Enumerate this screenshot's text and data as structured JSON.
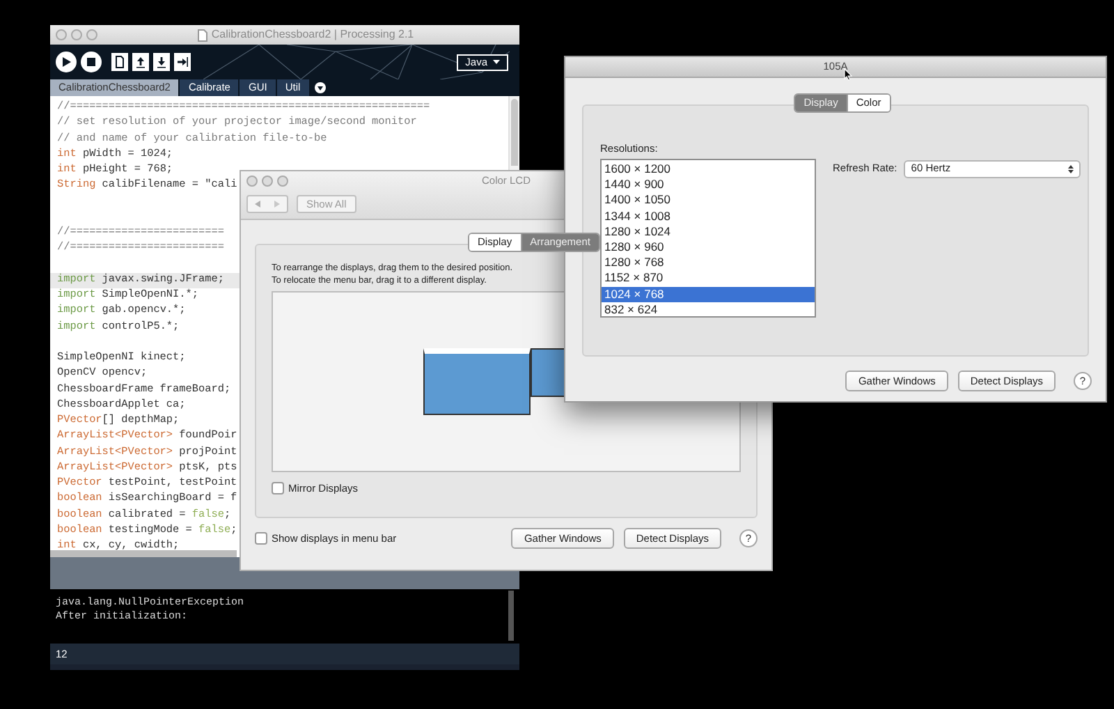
{
  "processing_window": {
    "title": "CalibrationChessboard2 | Processing 2.1",
    "toolbar": {
      "buttons": [
        {
          "kind": "run"
        },
        {
          "kind": "stop"
        },
        {
          "kind": "new"
        },
        {
          "kind": "open"
        },
        {
          "kind": "save"
        },
        {
          "kind": "export"
        }
      ],
      "mode": "Java"
    },
    "tabs": [
      {
        "label": "CalibrationChessboard2",
        "selected": true
      },
      {
        "label": "Calibrate",
        "selected": false
      },
      {
        "label": "GUI",
        "selected": false
      },
      {
        "label": "Util",
        "selected": false
      }
    ],
    "code_lines": [
      {
        "kind": "code",
        "highlighted": false,
        "segments": [
          {
            "text": "//========================================================",
            "kind": "comment"
          }
        ]
      },
      {
        "kind": "code",
        "highlighted": false,
        "segments": [
          {
            "text": "// set resolution of your projector image/second monitor",
            "kind": "comment"
          }
        ]
      },
      {
        "kind": "code",
        "highlighted": false,
        "segments": [
          {
            "text": "// and name of your calibration file-to-be",
            "kind": "comment"
          }
        ]
      },
      {
        "kind": "code",
        "highlighted": false,
        "segments": [
          {
            "text": "int",
            "kind": "type"
          },
          {
            "text": " pWidth = 1024;",
            "kind": "plain"
          }
        ]
      },
      {
        "kind": "code",
        "highlighted": false,
        "segments": [
          {
            "text": "int",
            "kind": "type"
          },
          {
            "text": " pHeight = 768;",
            "kind": "plain"
          }
        ]
      },
      {
        "kind": "code",
        "highlighted": false,
        "segments": [
          {
            "text": "String",
            "kind": "type"
          },
          {
            "text": " calibFilename = \"cali",
            "kind": "plain"
          }
        ]
      },
      {
        "kind": "blank"
      },
      {
        "kind": "blank"
      },
      {
        "kind": "code",
        "highlighted": false,
        "segments": [
          {
            "text": "//========================",
            "kind": "comment"
          }
        ]
      },
      {
        "kind": "code",
        "highlighted": false,
        "segments": [
          {
            "text": "//========================",
            "kind": "comment"
          }
        ]
      },
      {
        "kind": "blank"
      },
      {
        "kind": "code",
        "highlighted": true,
        "segments": [
          {
            "text": "import",
            "kind": "keyword"
          },
          {
            "text": " javax.swing.JFrame;",
            "kind": "plain"
          }
        ]
      },
      {
        "kind": "code",
        "highlighted": false,
        "segments": [
          {
            "text": "import",
            "kind": "keyword"
          },
          {
            "text": " SimpleOpenNI.*;",
            "kind": "plain"
          }
        ]
      },
      {
        "kind": "code",
        "highlighted": false,
        "segments": [
          {
            "text": "import",
            "kind": "keyword"
          },
          {
            "text": " gab.opencv.*;",
            "kind": "plain"
          }
        ]
      },
      {
        "kind": "code",
        "highlighted": false,
        "segments": [
          {
            "text": "import",
            "kind": "keyword"
          },
          {
            "text": " controlP5.*;",
            "kind": "plain"
          }
        ]
      },
      {
        "kind": "blank"
      },
      {
        "kind": "code",
        "highlighted": false,
        "segments": [
          {
            "text": "SimpleOpenNI kinect;",
            "kind": "plain"
          }
        ]
      },
      {
        "kind": "code",
        "highlighted": false,
        "segments": [
          {
            "text": "OpenCV opencv;",
            "kind": "plain"
          }
        ]
      },
      {
        "kind": "code",
        "highlighted": false,
        "segments": [
          {
            "text": "ChessboardFrame frameBoard;",
            "kind": "plain"
          }
        ]
      },
      {
        "kind": "code",
        "highlighted": false,
        "segments": [
          {
            "text": "ChessboardApplet ca;",
            "kind": "plain"
          }
        ]
      },
      {
        "kind": "code",
        "highlighted": false,
        "segments": [
          {
            "text": "PVector",
            "kind": "type"
          },
          {
            "text": "[] depthMap;",
            "kind": "plain"
          }
        ]
      },
      {
        "kind": "code",
        "highlighted": false,
        "segments": [
          {
            "text": "ArrayList<PVector>",
            "kind": "type"
          },
          {
            "text": " foundPoir",
            "kind": "plain"
          }
        ]
      },
      {
        "kind": "code",
        "highlighted": false,
        "segments": [
          {
            "text": "ArrayList<PVector>",
            "kind": "type"
          },
          {
            "text": " projPoint",
            "kind": "plain"
          }
        ]
      },
      {
        "kind": "code",
        "highlighted": false,
        "segments": [
          {
            "text": "ArrayList<PVector>",
            "kind": "type"
          },
          {
            "text": " ptsK, pts",
            "kind": "plain"
          }
        ]
      },
      {
        "kind": "code",
        "highlighted": false,
        "segments": [
          {
            "text": "PVector",
            "kind": "type"
          },
          {
            "text": " testPoint, testPoint",
            "kind": "plain"
          }
        ]
      },
      {
        "kind": "code",
        "highlighted": false,
        "segments": [
          {
            "text": "boolean",
            "kind": "type"
          },
          {
            "text": " isSearchingBoard = f",
            "kind": "plain"
          }
        ]
      },
      {
        "kind": "code",
        "highlighted": false,
        "segments": [
          {
            "text": "boolean",
            "kind": "type"
          },
          {
            "text": " calibrated = ",
            "kind": "plain"
          },
          {
            "text": "false",
            "kind": "literal"
          },
          {
            "text": ";",
            "kind": "plain"
          }
        ]
      },
      {
        "kind": "code",
        "highlighted": false,
        "segments": [
          {
            "text": "boolean",
            "kind": "type"
          },
          {
            "text": " testingMode = ",
            "kind": "plain"
          },
          {
            "text": "false",
            "kind": "literal"
          },
          {
            "text": ";",
            "kind": "plain"
          }
        ]
      },
      {
        "kind": "code",
        "highlighted": false,
        "segments": [
          {
            "text": "int",
            "kind": "type"
          },
          {
            "text": " cx, cy, cwidth;",
            "kind": "plain"
          }
        ]
      }
    ],
    "console_lines": [
      "java.lang.NullPointerException",
      "After initialization:"
    ],
    "line_number": "12"
  },
  "color_lcd_window": {
    "title": "Color LCD",
    "show_all": "Show All",
    "tabs": [
      {
        "label": "Display",
        "selected": false
      },
      {
        "label": "Arrangement",
        "selected": true
      }
    ],
    "instructions": [
      "To rearrange the displays, drag them to the desired position.",
      "To relocate the menu bar, drag it to a different display."
    ],
    "mirror_displays": {
      "label": "Mirror Displays",
      "checked": false
    },
    "show_in_menu_bar": {
      "label": "Show displays in menu bar",
      "checked": false
    },
    "buttons": [
      "Gather Windows",
      "Detect Displays"
    ],
    "help": "?"
  },
  "display_window": {
    "title": "105A",
    "tabs": [
      {
        "label": "Display",
        "selected": true
      },
      {
        "label": "Color",
        "selected": false
      }
    ],
    "resolutions_label": "Resolutions:",
    "resolutions": [
      {
        "label": "1600 × 1200",
        "selected": false
      },
      {
        "label": "1440 × 900",
        "selected": false
      },
      {
        "label": "1400 × 1050",
        "selected": false
      },
      {
        "label": "1344 × 1008",
        "selected": false
      },
      {
        "label": "1280 × 1024",
        "selected": false
      },
      {
        "label": "1280 × 960",
        "selected": false
      },
      {
        "label": "1280 × 768",
        "selected": false
      },
      {
        "label": "1152 × 870",
        "selected": false
      },
      {
        "label": "1024 × 768",
        "selected": true
      },
      {
        "label": "832 × 624",
        "selected": false
      }
    ],
    "refresh_rate": {
      "label": "Refresh Rate:",
      "value": "60 Hertz"
    },
    "buttons": [
      "Gather Windows",
      "Detect Displays"
    ],
    "help": "?"
  }
}
